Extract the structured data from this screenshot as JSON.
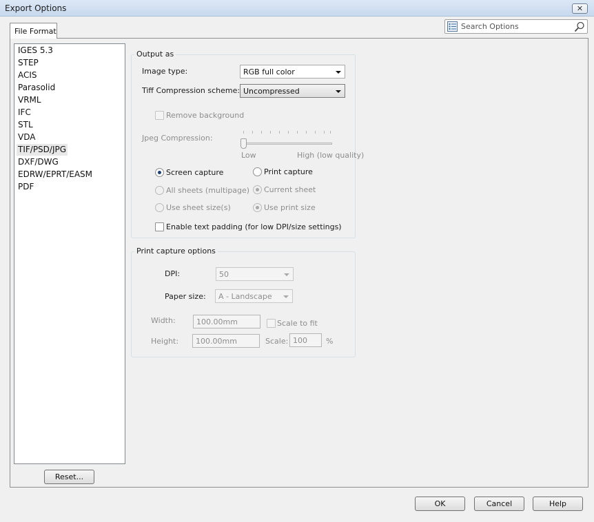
{
  "window": {
    "title": "Export Options",
    "close_glyph": "✕"
  },
  "tabs": [
    {
      "label": "File Format"
    }
  ],
  "search": {
    "placeholder": "Search Options",
    "icon_left": "options-list-icon",
    "icon_right": "magnifier-icon"
  },
  "format_list": {
    "items": [
      "IGES 5.3",
      "STEP",
      "ACIS",
      "Parasolid",
      "VRML",
      "IFC",
      "STL",
      "VDA",
      "TIF/PSD/JPG",
      "DXF/DWG",
      "EDRW/EPRT/EASM",
      "PDF"
    ],
    "selected": "TIF/PSD/JPG"
  },
  "reset_label": "Reset...",
  "output_as": {
    "title": "Output as",
    "image_type_label": "Image type:",
    "image_type_value": "RGB full color",
    "tiff_label": "Tiff Compression scheme:",
    "tiff_value": "Uncompressed",
    "remove_background_label": "Remove background",
    "jpeg_label": "Jpeg Compression:",
    "jpeg_low": "Low",
    "jpeg_high": "High (low quality)",
    "jpeg_level": 0,
    "screen_capture": "Screen capture",
    "print_capture": "Print capture",
    "all_sheets": "All sheets (multipage)",
    "current_sheet": "Current sheet",
    "use_sheet_size": "Use sheet size(s)",
    "use_print_size": "Use print size",
    "enable_padding": "Enable text padding (for low DPI/size settings)",
    "selected_capture": "Screen capture"
  },
  "print_capture_options": {
    "title": "Print capture options",
    "dpi_label": "DPI:",
    "dpi_value": "50",
    "paper_label": "Paper size:",
    "paper_value": "A - Landscape",
    "width_label": "Width:",
    "width_value": "100.00mm",
    "height_label": "Height:",
    "height_value": "100.00mm",
    "scale_to_fit_label": "Scale to fit",
    "scale_label": "Scale:",
    "scale_value": "100",
    "scale_unit": "%"
  },
  "footer": {
    "ok": "OK",
    "cancel": "Cancel",
    "help": "Help"
  }
}
